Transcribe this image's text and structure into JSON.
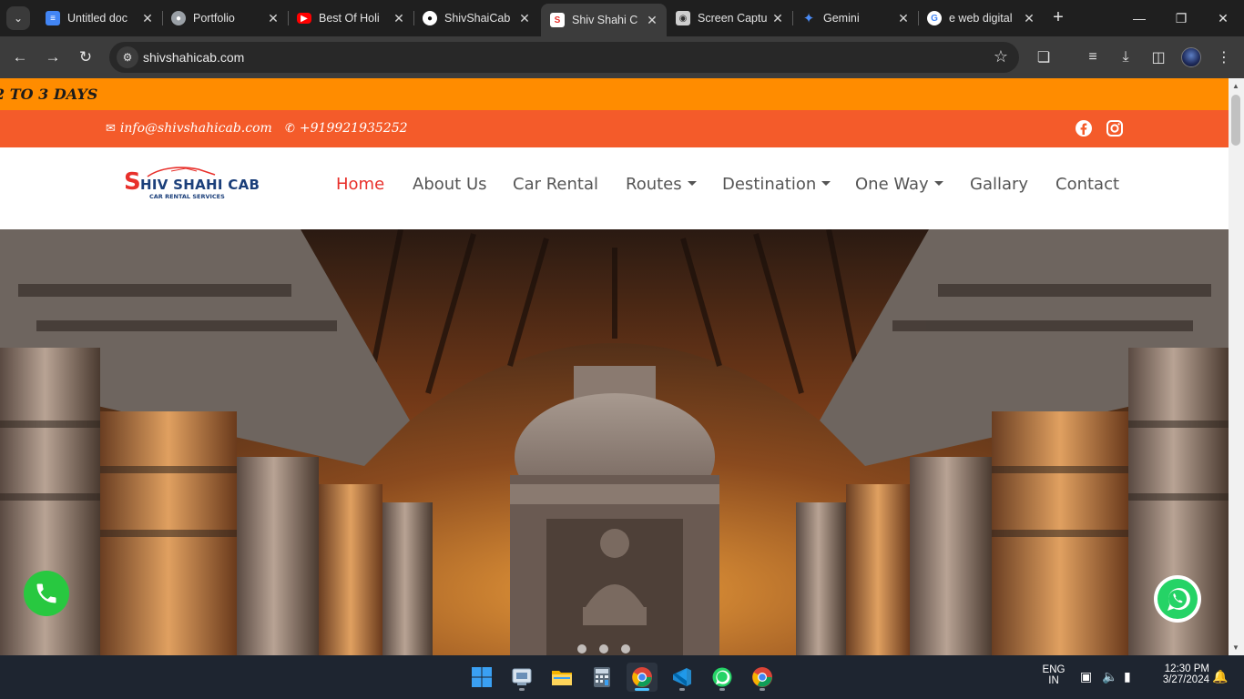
{
  "browser": {
    "tabs": [
      {
        "title": "Untitled doc",
        "favicon": "google-docs-icon",
        "color": "#4285f4",
        "active": false
      },
      {
        "title": "Portfolio",
        "favicon": "globe-icon",
        "color": "#9aa0a6",
        "active": false
      },
      {
        "title": "Best Of Holi",
        "favicon": "youtube-icon",
        "color": "#ff0000",
        "active": false
      },
      {
        "title": "ShivShaiCab",
        "favicon": "github-icon",
        "color": "#ffffff",
        "active": false
      },
      {
        "title": "Shiv Shahi C",
        "favicon": "shivshahi-logo-icon",
        "color": "#ffffff",
        "active": true
      },
      {
        "title": "Screen Captu",
        "favicon": "camera-icon",
        "color": "#cfcfcf",
        "active": false
      },
      {
        "title": "Gemini",
        "favicon": "gemini-icon",
        "color": "#4a8bf5",
        "active": false
      },
      {
        "title": "e web digital",
        "favicon": "google-icon",
        "color": "#ffffff",
        "active": false
      }
    ],
    "url": "shivshahicab.com"
  },
  "site": {
    "marquee_text": "2 TO 3 DAYS",
    "email": "info@shivshahicab.com",
    "phone": "+919921935252",
    "logo": {
      "initial": "S",
      "name": "HIV SHAHI CAB",
      "tagline": "CAR RENTAL SERVICES"
    },
    "nav": [
      {
        "label": "Home",
        "active": true,
        "dropdown": false
      },
      {
        "label": "About Us",
        "active": false,
        "dropdown": false
      },
      {
        "label": "Car Rental",
        "active": false,
        "dropdown": false
      },
      {
        "label": "Routes",
        "active": false,
        "dropdown": true
      },
      {
        "label": "Destination",
        "active": false,
        "dropdown": true
      },
      {
        "label": "One Way",
        "active": false,
        "dropdown": true
      },
      {
        "label": "Gallary",
        "active": false,
        "dropdown": false
      },
      {
        "label": "Contact",
        "active": false,
        "dropdown": false
      }
    ],
    "colors": {
      "marquee": "#ff8c00",
      "topbar": "#f45b2a",
      "active_nav": "#e8302b",
      "call_button": "#28c840",
      "whatsapp": "#25d366"
    },
    "slider_dots": 3
  },
  "taskbar": {
    "apps": [
      "windows-start-icon",
      "screen-capture-app-icon",
      "file-explorer-icon",
      "calculator-icon",
      "chrome-icon",
      "vscode-icon",
      "whatsapp-icon",
      "chrome-icon"
    ],
    "language": "ENG",
    "region": "IN",
    "time": "12:30 PM",
    "date": "3/27/2024"
  }
}
